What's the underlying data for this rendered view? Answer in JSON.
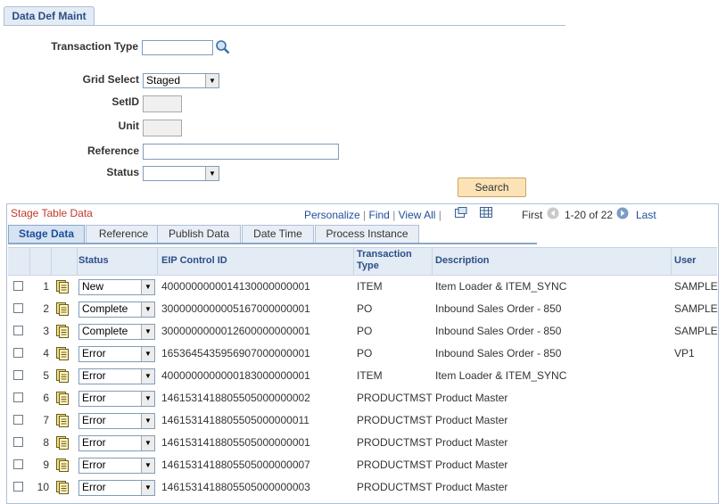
{
  "page": {
    "tab_label": "Data Def Maint"
  },
  "form": {
    "transaction_type": {
      "label": "Transaction Type",
      "value": ""
    },
    "grid_select": {
      "label": "Grid Select",
      "value": "Staged"
    },
    "setid": {
      "label": "SetID",
      "value": ""
    },
    "unit": {
      "label": "Unit",
      "value": ""
    },
    "reference": {
      "label": "Reference",
      "value": ""
    },
    "status": {
      "label": "Status",
      "value": ""
    },
    "search_label": "Search"
  },
  "grid": {
    "title": "Stage Table Data",
    "personalize": "Personalize",
    "find": "Find",
    "view_all": "View All",
    "first": "First",
    "range": "1-20 of 22",
    "last": "Last",
    "tabs": [
      "Stage Data",
      "Reference",
      "Publish Data",
      "Date Time",
      "Process Instance"
    ],
    "columns": {
      "status": "Status",
      "eip": "EIP Control ID",
      "ttype_1": "Transaction",
      "ttype_2": "Type",
      "description": "Description",
      "user": "User"
    },
    "rows": [
      {
        "num": "1",
        "status": "New",
        "eip": "4000000000014130000000001",
        "ttype": "ITEM",
        "desc": "Item Loader & ITEM_SYNC",
        "user": "SAMPLE"
      },
      {
        "num": "2",
        "status": "Complete",
        "eip": "3000000000005167000000001",
        "ttype": "PO",
        "desc": "Inbound Sales Order - 850",
        "user": "SAMPLE"
      },
      {
        "num": "3",
        "status": "Complete",
        "eip": "3000000000012600000000001",
        "ttype": "PO",
        "desc": "Inbound Sales Order - 850",
        "user": "SAMPLE"
      },
      {
        "num": "4",
        "status": "Error",
        "eip": "1653645435956907000000001",
        "ttype": "PO",
        "desc": "Inbound Sales Order - 850",
        "user": "VP1"
      },
      {
        "num": "5",
        "status": "Error",
        "eip": "4000000000000183000000001",
        "ttype": "ITEM",
        "desc": "Item Loader & ITEM_SYNC",
        "user": ""
      },
      {
        "num": "6",
        "status": "Error",
        "eip": "1461531418805505000000002",
        "ttype": "PRODUCTMST",
        "desc": "Product Master",
        "user": ""
      },
      {
        "num": "7",
        "status": "Error",
        "eip": "1461531418805505000000011",
        "ttype": "PRODUCTMST",
        "desc": "Product Master",
        "user": ""
      },
      {
        "num": "8",
        "status": "Error",
        "eip": "1461531418805505000000001",
        "ttype": "PRODUCTMST",
        "desc": "Product Master",
        "user": ""
      },
      {
        "num": "9",
        "status": "Error",
        "eip": "1461531418805505000000007",
        "ttype": "PRODUCTMST",
        "desc": "Product Master",
        "user": ""
      },
      {
        "num": "10",
        "status": "Error",
        "eip": "1461531418805505000000003",
        "ttype": "PRODUCTMST",
        "desc": "Product Master",
        "user": ""
      }
    ]
  }
}
